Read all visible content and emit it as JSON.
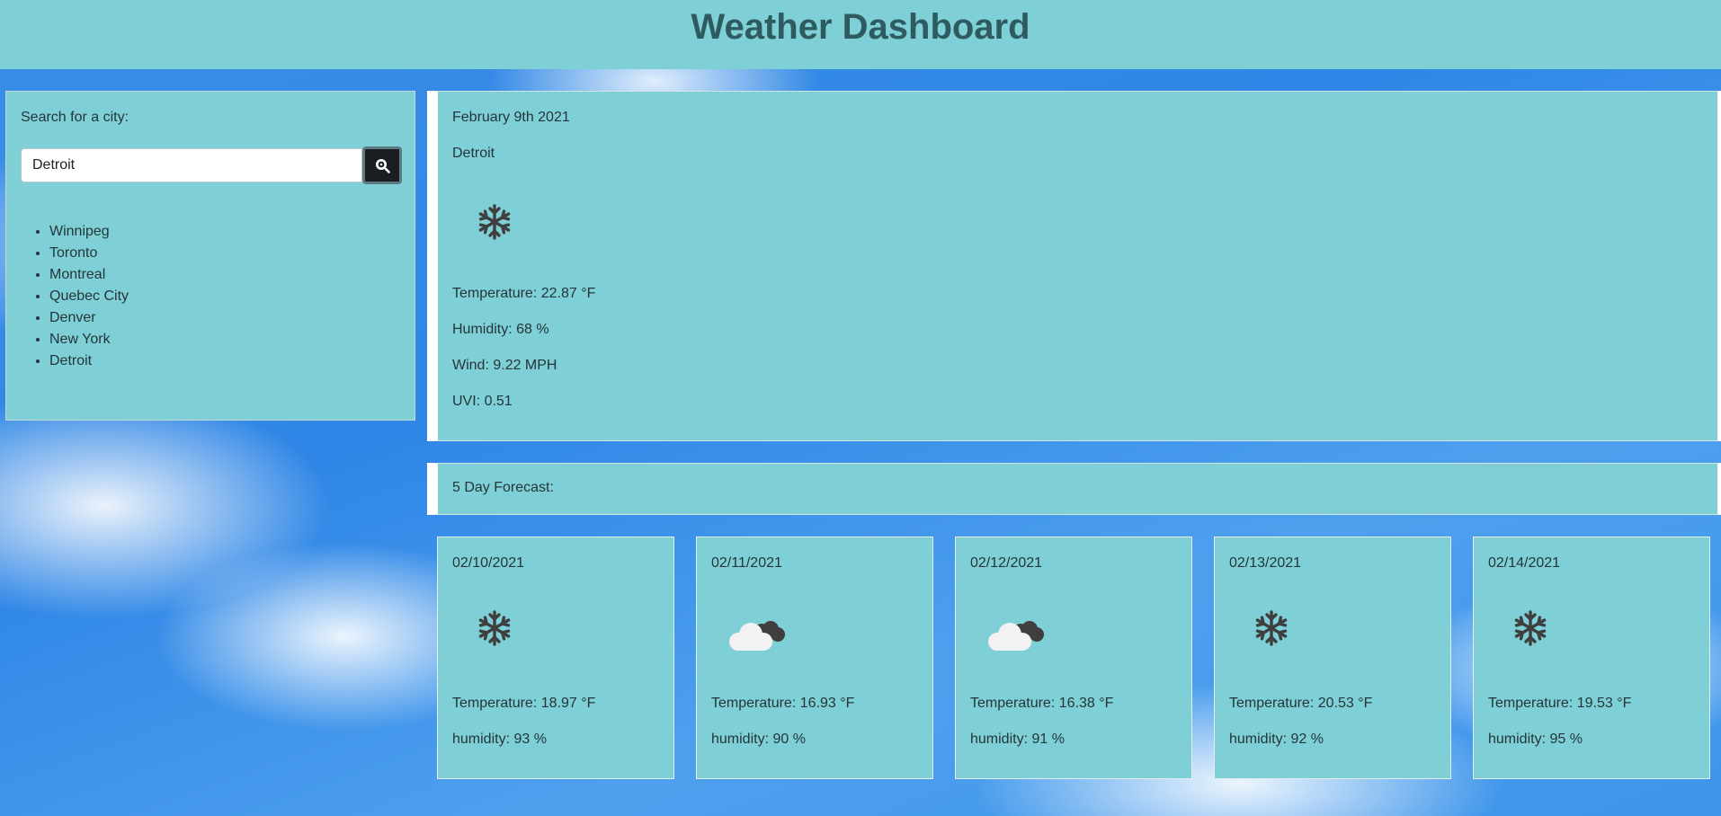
{
  "header": {
    "title": "Weather Dashboard"
  },
  "search": {
    "label": "Search for a city:",
    "input_value": "Detroit",
    "button_icon": "search-icon"
  },
  "history": [
    "Winnipeg",
    "Toronto",
    "Montreal",
    "Quebec City",
    "Denver",
    "New York",
    "Detroit"
  ],
  "current": {
    "date": "February 9th 2021",
    "city": "Detroit",
    "icon": "snowflake-icon",
    "temperature": "Temperature: 22.87 °F",
    "humidity": "Humidity: 68 %",
    "wind": "Wind: 9.22 MPH",
    "uvi": "UVI: 0.51"
  },
  "forecast": {
    "heading": "5 Day Forecast:",
    "days": [
      {
        "date": "02/10/2021",
        "icon": "snowflake-icon",
        "temperature": "Temperature: 18.97 °F",
        "humidity": "humidity: 93 %"
      },
      {
        "date": "02/11/2021",
        "icon": "cloudy-icon",
        "temperature": "Temperature: 16.93 °F",
        "humidity": "humidity: 90 %"
      },
      {
        "date": "02/12/2021",
        "icon": "cloudy-icon",
        "temperature": "Temperature: 16.38 °F",
        "humidity": "humidity: 91 %"
      },
      {
        "date": "02/13/2021",
        "icon": "snowflake-icon",
        "temperature": "Temperature: 20.53 °F",
        "humidity": "humidity: 92 %"
      },
      {
        "date": "02/14/2021",
        "icon": "snowflake-icon",
        "temperature": "Temperature: 19.53 °F",
        "humidity": "humidity: 95 %"
      }
    ]
  },
  "colors": {
    "panel": "#7ecfd6",
    "title": "#2e5b60",
    "button": "#1b1e21"
  }
}
